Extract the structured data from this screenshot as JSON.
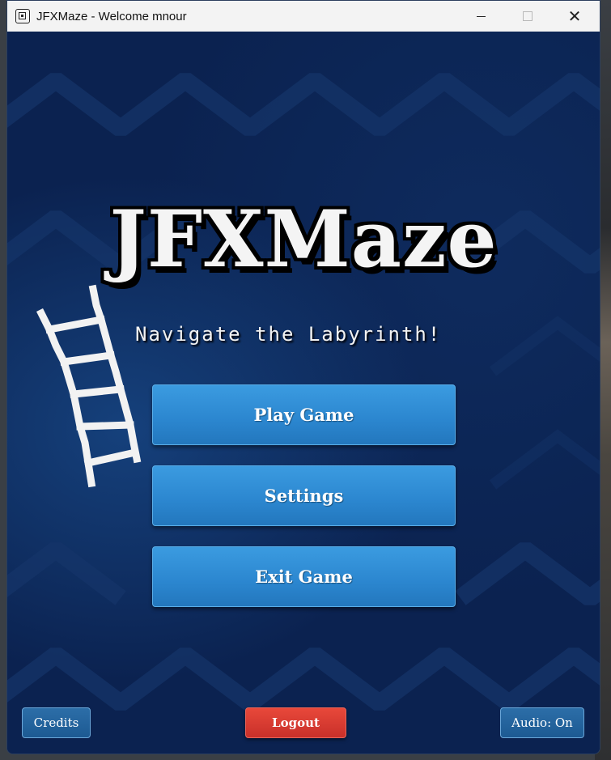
{
  "window": {
    "title": "JFXMaze - Welcome mnour",
    "icons": {
      "app": "maze-app-icon",
      "minimize": "minimize-icon",
      "maximize": "maximize-icon",
      "close": "close-icon"
    },
    "close_glyph": "✕"
  },
  "main": {
    "logo": "JFXMaze",
    "tagline": "Navigate the Labyrinth!",
    "buttons": [
      {
        "label": "Play Game"
      },
      {
        "label": "Settings"
      },
      {
        "label": "Exit Game"
      }
    ]
  },
  "footer": {
    "credits_label": "Credits",
    "logout_label": "Logout",
    "audio_label": "Audio: On"
  },
  "colors": {
    "background": "#0b2250",
    "menu_button": "#2b86cf",
    "logout_button": "#d63a30",
    "secondary_button": "#1f5e98",
    "logo_text": "#f4f4f4"
  }
}
